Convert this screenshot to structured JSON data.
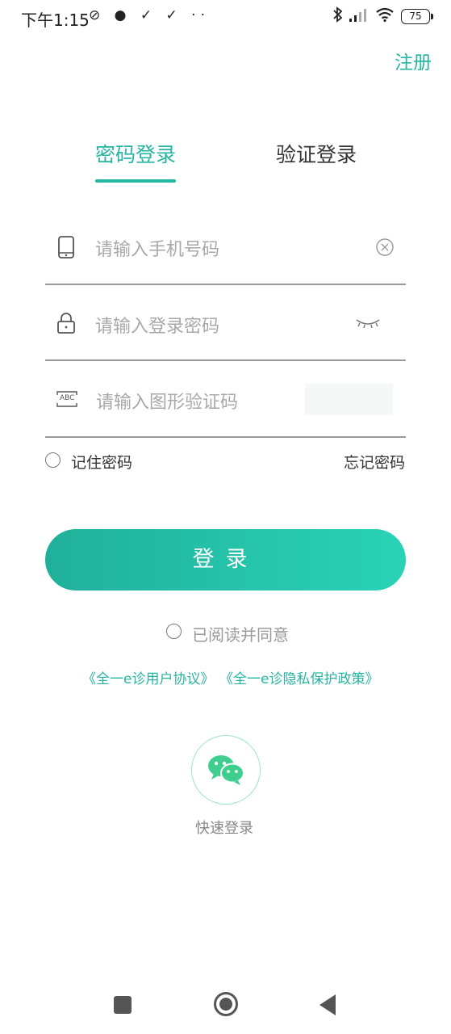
{
  "status_bar": {
    "time": "下午1:15",
    "left_icons": "⊘ ● ✓ ✓ ··",
    "battery": "75"
  },
  "header": {
    "register_label": "注册"
  },
  "tabs": [
    {
      "label": "密码登录",
      "active": true
    },
    {
      "label": "验证登录",
      "active": false
    }
  ],
  "form": {
    "phone_placeholder": "请输入手机号码",
    "password_placeholder": "请输入登录密码",
    "captcha_placeholder": "请输入图形验证码",
    "captcha_icon_text": "ABC",
    "remember_label": "记住密码",
    "forgot_label": "忘记密码",
    "login_label": "登录"
  },
  "agreement": {
    "agree_label": "已阅读并同意",
    "user_agreement": "《全一e诊用户协议》",
    "privacy_policy": "《全一e诊隐私保护政策》"
  },
  "quick_login": {
    "label": "快速登录"
  },
  "colors": {
    "accent": "#26b5a1",
    "button_start": "#20b09a",
    "button_end": "#2ad3b6"
  },
  "icons": [
    "phone-icon",
    "clear-icon",
    "lock-icon",
    "eye-closed-icon",
    "captcha-icon",
    "wechat-icon",
    "bluetooth-icon",
    "signal-icon",
    "wifi-icon",
    "battery-icon"
  ]
}
